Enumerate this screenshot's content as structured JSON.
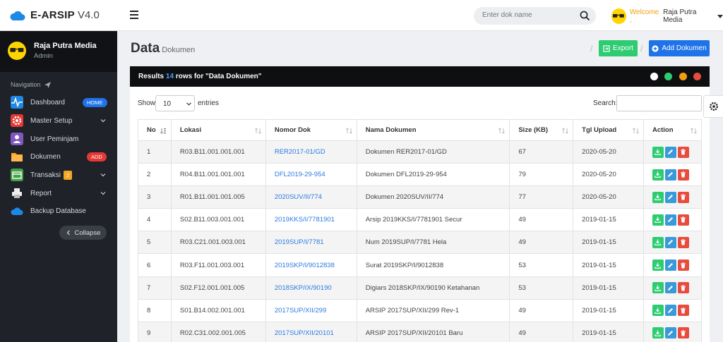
{
  "brand": {
    "name": "E-ARSIP",
    "version": "V4.0"
  },
  "header": {
    "search_placeholder": "Enter dok name",
    "welcome": "Welcome ,",
    "user": "Raja Putra Media"
  },
  "sidebar": {
    "user_name": "Raja Putra Media",
    "user_role": "Admin",
    "nav_title": "Navigation",
    "items": [
      {
        "label": "Dashboard",
        "badge": "HOME",
        "badge_color": "#1e73e8",
        "icon": "pulse-icon",
        "icon_color": "#1e88e5"
      },
      {
        "label": "Master Setup",
        "icon": "settings-icon",
        "icon_color": "#e53935"
      },
      {
        "label": "User Peminjam",
        "icon": "user-icon",
        "icon_color": "#7e57c2"
      },
      {
        "label": "Dokumen",
        "badge": "ADD",
        "badge_color": "#e53935",
        "icon": "folder-icon",
        "icon_color": "#ffa726"
      },
      {
        "label": "Transaksi",
        "badge": "2",
        "badge_color": "#f5a623",
        "icon": "transaction-icon",
        "icon_color": "#43a047"
      },
      {
        "label": "Report",
        "icon": "printer-icon",
        "icon_color": "#eeeeee"
      },
      {
        "label": "Backup Database",
        "icon": "cloud-icon",
        "icon_color": "#1e88e5"
      }
    ],
    "collapse": "Collapse"
  },
  "page": {
    "title": "Data",
    "subtitle": "Dokumen",
    "export": "Export",
    "add": "Add Dokumen"
  },
  "panel": {
    "results_pre": "Results",
    "results_count": "14",
    "results_post": "rows for \"Data Dokumen\"",
    "show": "Show",
    "show_value": "10",
    "entries": "entries",
    "search": "Search:"
  },
  "table": {
    "columns": [
      "No",
      "Lokasi",
      "Nomor Dok",
      "Nama Dokumen",
      "Size (KB)",
      "Tgl Upload",
      "Action"
    ],
    "rows": [
      [
        "1",
        "R03.B11.001.001.001",
        "RER2017-01/GD",
        "Dokumen RER2017-01/GD",
        "67",
        "2020-05-20"
      ],
      [
        "2",
        "R04.B11.001.001.001",
        "DFL2019-29-954",
        "Dokumen DFL2019-29-954",
        "79",
        "2020-05-20"
      ],
      [
        "3",
        "R01.B11.001.001.005",
        "2020SUV/II/774",
        "Dokumen 2020SUV/II/774",
        "77",
        "2020-05-20"
      ],
      [
        "4",
        "S02.B11.003.001.001",
        "2019KKS/I/7781901",
        "Arsip 2019KKS/I/7781901 Secur",
        "49",
        "2019-01-15"
      ],
      [
        "5",
        "R03.C21.001.003.001",
        "2019SUP/I/7781",
        "Num 2019SUP/I/7781 Hela",
        "49",
        "2019-01-15"
      ],
      [
        "6",
        "R03.F11.001.003.001",
        "2019SKP/I/9012838",
        "Surat 2019SKP/I/9012838",
        "53",
        "2019-01-15"
      ],
      [
        "7",
        "S02.F12.001.001.005",
        "2018SKP/IX/90190",
        "Digiars 2018SKP/IX/90190 Ketahanan",
        "53",
        "2019-01-15"
      ],
      [
        "8",
        "S01.B14.002.001.001",
        "2017SUP/XII/299",
        "ARSIP 2017SUP/XII/299 Rev-1",
        "49",
        "2019-01-15"
      ],
      [
        "9",
        "R02.C31.002.001.005",
        "2017SUP/XII/20101",
        "ARSIP 2017SUP/XII/20101 Baru",
        "49",
        "2019-01-15"
      ]
    ]
  }
}
